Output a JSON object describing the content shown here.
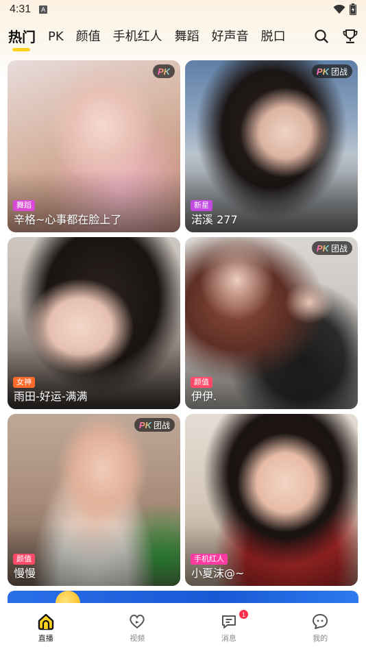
{
  "status": {
    "time": "4:31",
    "indicator": "A"
  },
  "tabs": [
    {
      "label": "热门",
      "active": true
    },
    {
      "label": "PK"
    },
    {
      "label": "颜值"
    },
    {
      "label": "手机红人"
    },
    {
      "label": "舞蹈"
    },
    {
      "label": "好声音"
    },
    {
      "label": "脱口"
    }
  ],
  "tab_icons": [
    "search-icon",
    "trophy-icon"
  ],
  "cards": [
    {
      "title": "辛格~心事都在脸上了",
      "tag": "舞蹈",
      "tag_color": "#d94bd6",
      "pk": "PK",
      "pk_extra": ""
    },
    {
      "title": "渃溪 277",
      "tag": "新星",
      "tag_color": "#c24ae0",
      "pk": "PK",
      "pk_extra": "团战"
    },
    {
      "title": "雨田-好运-满满",
      "tag": "女神",
      "tag_color": "#ff6a2a",
      "pk": "",
      "pk_extra": ""
    },
    {
      "title": "伊伊.",
      "tag": "颜值",
      "tag_color": "#ff4a6a",
      "pk": "PK",
      "pk_extra": "团战"
    },
    {
      "title": "慢慢",
      "tag": "颜值",
      "tag_color": "#ff4a6a",
      "pk": "PK",
      "pk_extra": "团战"
    },
    {
      "title": "小夏沫@~",
      "tag": "手机红人",
      "tag_color": "#ff3aa0",
      "pk": "",
      "pk_extra": ""
    }
  ],
  "nav": [
    {
      "label": "直播",
      "icon": "live-home-icon",
      "active": true
    },
    {
      "label": "视频",
      "icon": "heart-video-icon"
    },
    {
      "label": "消息",
      "icon": "message-icon",
      "badge": "1"
    },
    {
      "label": "我的",
      "icon": "profile-icon"
    }
  ],
  "colors": {
    "accent": "#ffd21f",
    "badge": "#ff2d4b"
  }
}
